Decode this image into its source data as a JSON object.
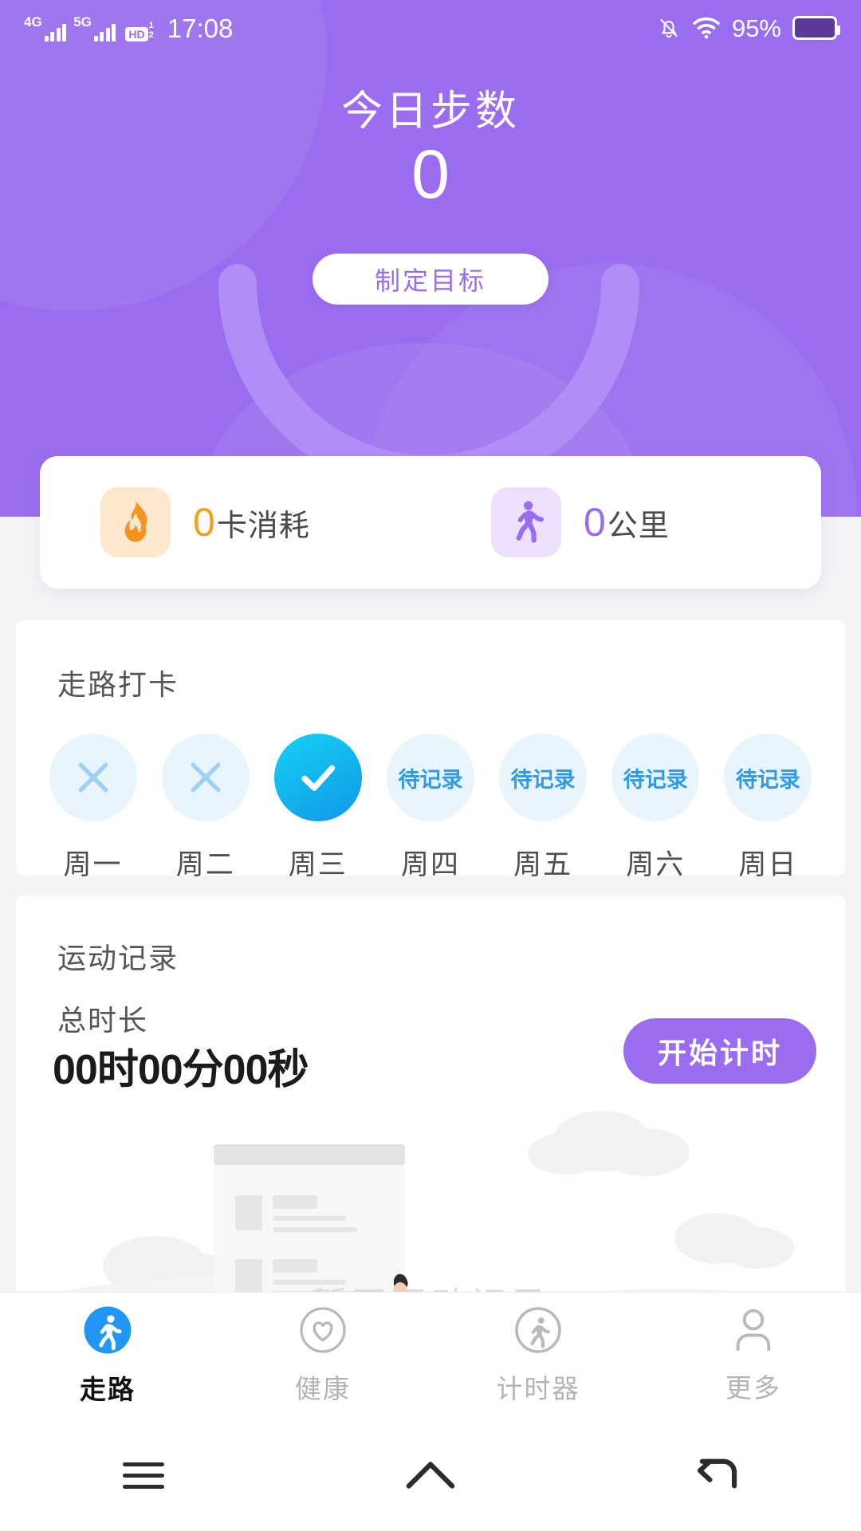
{
  "status_bar": {
    "network_1": "4G",
    "network_2": "5G",
    "hd_label": "HD",
    "hd_num_top": "1",
    "hd_num_bottom": "2",
    "time": "17:08",
    "battery_percent": "95%",
    "icons": [
      "mute-bell-icon",
      "wifi-icon",
      "battery-icon"
    ]
  },
  "header": {
    "title": "今日步数",
    "steps_value": "0",
    "goal_button": "制定目标",
    "bg_color": "#9a6df0",
    "accent_color": "#a985f5"
  },
  "stats": [
    {
      "icon": "flame-icon",
      "value": "0",
      "label": "卡消耗",
      "value_color": "#f3a01c",
      "chip_color": "#fde8cf"
    },
    {
      "icon": "walking-person-icon",
      "value": "0",
      "label": "公里",
      "value_color": "#9a6df0",
      "chip_color": "#ece0fd"
    }
  ],
  "checkin": {
    "title": "走路打卡",
    "days": [
      {
        "label": "周一",
        "state": "missed",
        "mark": "×"
      },
      {
        "label": "周二",
        "state": "missed",
        "mark": "×"
      },
      {
        "label": "周三",
        "state": "done",
        "mark": "✓"
      },
      {
        "label": "周四",
        "state": "pending",
        "mark": "待记录"
      },
      {
        "label": "周五",
        "state": "pending",
        "mark": "待记录"
      },
      {
        "label": "周六",
        "state": "pending",
        "mark": "待记录"
      },
      {
        "label": "周日",
        "state": "pending",
        "mark": "待记录"
      }
    ],
    "done_color": "#1296e8",
    "pending_color": "#2f9ae8"
  },
  "record": {
    "title": "运动记录",
    "total_label": "总时长",
    "total_value": "00时00分00秒",
    "start_button": "开始计时",
    "empty_text": "暂无运动记录"
  },
  "tabs": [
    {
      "label": "走路",
      "icon": "runner-filled-icon",
      "active": true
    },
    {
      "label": "健康",
      "icon": "heart-outline-icon",
      "active": false
    },
    {
      "label": "计时器",
      "icon": "runner-outline-icon",
      "active": false
    },
    {
      "label": "更多",
      "icon": "person-outline-icon",
      "active": false
    }
  ],
  "nav_bar": {
    "items": [
      "menu-icon",
      "home-icon",
      "back-icon"
    ]
  }
}
